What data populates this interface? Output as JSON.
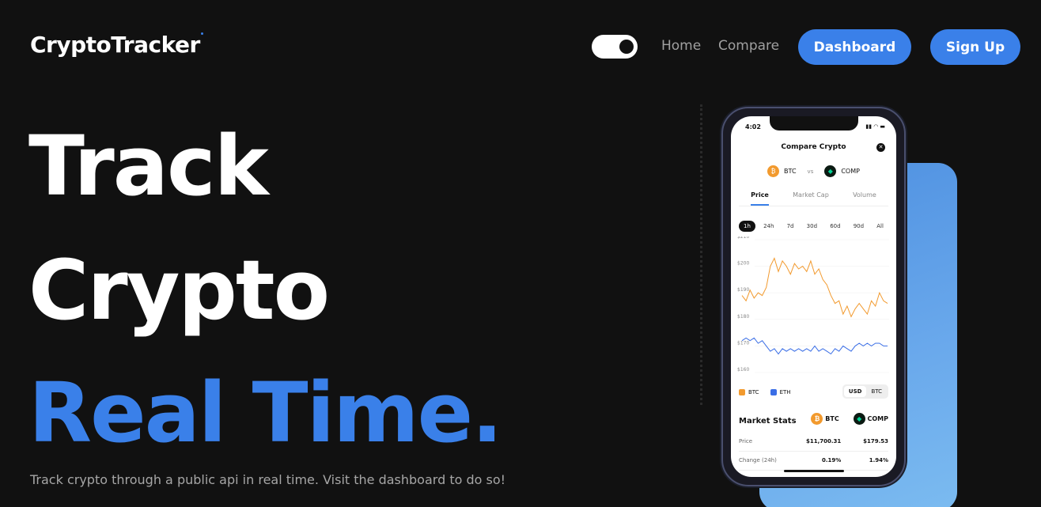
{
  "header": {
    "logo": "CryptoTracker",
    "nav": {
      "home": "Home",
      "compare": "Compare"
    },
    "dashboard_label": "Dashboard",
    "signup_label": "Sign Up",
    "theme_toggle": "on"
  },
  "hero": {
    "line1": "Track",
    "line2": "Crypto",
    "line3": "Real Time.",
    "subtitle": "Track crypto through a public api in real time. Visit the dashboard to do so!"
  },
  "colors": {
    "background": "#111111",
    "accent": "#3a80e9",
    "btc": "#f29a2e",
    "eth": "#3a6ee6"
  },
  "phone": {
    "time": "4:02",
    "title": "Compare Crypto",
    "coin1": "BTC",
    "vs": "vs",
    "coin2": "COMP",
    "tabs": [
      "Price",
      "Market Cap",
      "Volume"
    ],
    "ranges": [
      "1h",
      "24h",
      "7d",
      "30d",
      "60d",
      "90d",
      "All"
    ],
    "legend": {
      "btc": "BTC",
      "eth": "ETH"
    },
    "currency": [
      "USD",
      "BTC"
    ],
    "market_stats_title": "Market Stats",
    "stats": [
      {
        "label": "Price",
        "btc": "$11,700.31",
        "comp": "$179.53"
      },
      {
        "label": "Change (24h)",
        "btc": "0.19%",
        "comp": "1.94%"
      }
    ]
  },
  "chart_data": {
    "type": "line",
    "ylim": [
      160,
      210
    ],
    "yticks": [
      "$210",
      "$200",
      "$190",
      "$180",
      "$170",
      "$160"
    ],
    "series": [
      {
        "name": "BTC",
        "values": [
          189,
          187,
          191,
          188,
          190,
          189,
          192,
          200,
          203,
          198,
          202,
          200,
          197,
          201,
          199,
          200,
          198,
          202,
          197,
          199,
          195,
          193,
          189,
          186,
          187,
          182,
          185,
          181,
          184,
          186,
          184,
          182,
          187,
          185,
          190,
          187,
          186
        ]
      },
      {
        "name": "ETH",
        "values": [
          172,
          173,
          172,
          173,
          171,
          172,
          170,
          168,
          169,
          167,
          169,
          168,
          169,
          168,
          169,
          168,
          169,
          168,
          170,
          168,
          169,
          168,
          167,
          169,
          168,
          170,
          169,
          168,
          170,
          171,
          170,
          171,
          170,
          171,
          171,
          170,
          170
        ]
      }
    ]
  }
}
